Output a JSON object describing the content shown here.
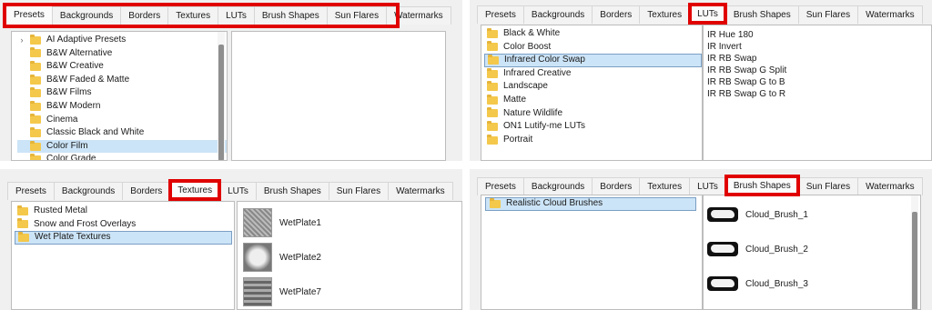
{
  "panels": {
    "presets": {
      "tabs": [
        "Presets",
        "Backgrounds",
        "Borders",
        "Textures",
        "LUTs",
        "Brush Shapes",
        "Sun Flares",
        "Watermarks"
      ],
      "active": "Presets",
      "items": [
        "AI Adaptive Presets",
        "B&W Alternative",
        "B&W Creative",
        "B&W Faded & Matte",
        "B&W Films",
        "B&W Modern",
        "Cinema",
        "Classic Black and White",
        "Color Film",
        "Color Grade"
      ],
      "selected": "Color Film"
    },
    "luts": {
      "tabs": [
        "Presets",
        "Backgrounds",
        "Borders",
        "Textures",
        "LUTs",
        "Brush Shapes",
        "Sun Flares",
        "Watermarks"
      ],
      "active": "LUTs",
      "items": [
        "Black & White",
        "Color Boost",
        "Infrared Color Swap",
        "Infrared Creative",
        "Landscape",
        "Matte",
        "Nature Wildlife",
        "ON1 Lutify-me LUTs",
        "Portrait"
      ],
      "selected": "Infrared Color Swap",
      "files": [
        "IR Hue 180",
        "IR Invert",
        "IR RB Swap",
        "IR RB Swap G Split",
        "IR RB Swap G to B",
        "IR RB Swap G to R"
      ]
    },
    "textures": {
      "tabs": [
        "Presets",
        "Backgrounds",
        "Borders",
        "Textures",
        "LUTs",
        "Brush Shapes",
        "Sun Flares",
        "Watermarks"
      ],
      "active": "Textures",
      "items": [
        "Rusted Metal",
        "Snow and Frost Overlays",
        "Wet Plate Textures"
      ],
      "selected": "Wet Plate Textures",
      "files": [
        "WetPlate1",
        "WetPlate2",
        "WetPlate7"
      ]
    },
    "brushes": {
      "tabs": [
        "Presets",
        "Backgrounds",
        "Borders",
        "Textures",
        "LUTs",
        "Brush Shapes",
        "Sun Flares",
        "Watermarks"
      ],
      "active": "Brush Shapes",
      "items": [
        "Realistic Cloud Brushes"
      ],
      "selected": "Realistic Cloud Brushes",
      "files": [
        "Cloud_Brush_1",
        "Cloud_Brush_2",
        "Cloud_Brush_3"
      ]
    }
  },
  "colors": {
    "highlight": "#e00000",
    "folder": "#f4c84b",
    "selection": "#cce4f7"
  },
  "icons": {
    "folder": "folder-icon",
    "expand": "chevron-right-icon"
  }
}
